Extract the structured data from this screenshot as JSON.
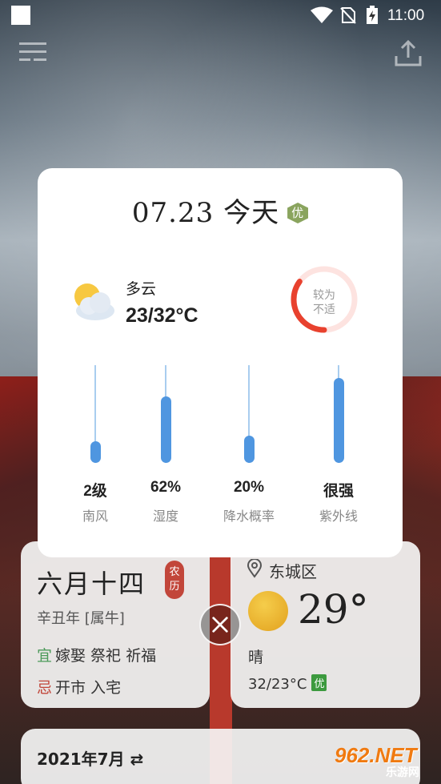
{
  "status_bar": {
    "time": "11:00"
  },
  "popup": {
    "title_date": "07.23",
    "title_day": "今天",
    "aqi_badge": "优",
    "condition": "多云",
    "temp_range": "23/32°C",
    "comfort_line1": "较为",
    "comfort_line2": "不适",
    "comfort_level_fraction": 0.35,
    "metrics": [
      {
        "value": "2级",
        "label": "南风",
        "level": 0.22
      },
      {
        "value": "62%",
        "label": "湿度",
        "level": 0.68
      },
      {
        "value": "20%",
        "label": "降水概率",
        "level": 0.28
      },
      {
        "value": "很强",
        "label": "紫外线",
        "level": 0.87
      }
    ],
    "colors": {
      "bar": "#4f96e0",
      "track": "#a9cdef",
      "ring": "#e8412e",
      "aqi": "#8aa45e"
    }
  },
  "lunar_card": {
    "date": "六月十四",
    "badge": "农历",
    "year": "辛丑年 [属牛]",
    "yi_mark": "宜",
    "yi_items": "嫁娶 祭祀 祈福",
    "ji_mark": "忌",
    "ji_items": "开市 入宅"
  },
  "weather_card": {
    "location": "东城区",
    "temperature": "29°",
    "condition": "晴",
    "range": "32/23°C",
    "aqi": "优"
  },
  "calendar_card": {
    "title": "2021年7月 ⇄"
  },
  "watermark": {
    "main": "962.NET",
    "sub": "乐游网"
  }
}
